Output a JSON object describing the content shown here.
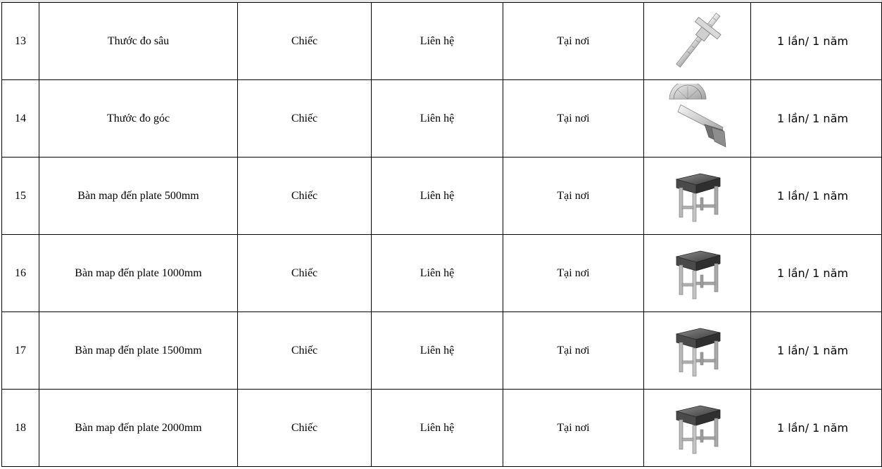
{
  "rows": [
    {
      "no": "13",
      "name": "Thước đo sâu",
      "unit": "Chiếc",
      "price": "Liên hệ",
      "place": "Tại nơi",
      "image": "depth-gauge-icon",
      "frequency": "1 lần/ 1 năm"
    },
    {
      "no": "14",
      "name": "Thước đo góc",
      "unit": "Chiếc",
      "price": "Liên hệ",
      "place": "Tại nơi",
      "image": "protractor-icon",
      "frequency": "1 lần/ 1 năm"
    },
    {
      "no": "15",
      "name": "Bàn map đến plate 500mm",
      "unit": "Chiếc",
      "price": "Liên hệ",
      "place": "Tại nơi",
      "image": "surface-plate-icon",
      "frequency": "1 lần/ 1 năm"
    },
    {
      "no": "16",
      "name": "Bàn map đến plate 1000mm",
      "unit": "Chiếc",
      "price": "Liên hệ",
      "place": "Tại nơi",
      "image": "surface-plate-icon",
      "frequency": "1 lần/ 1 năm"
    },
    {
      "no": "17",
      "name": "Bàn map đến plate 1500mm",
      "unit": "Chiếc",
      "price": "Liên hệ",
      "place": "Tại nơi",
      "image": "surface-plate-icon",
      "frequency": "1 lần/ 1 năm"
    },
    {
      "no": "18",
      "name": "Bàn map đến plate 2000mm",
      "unit": "Chiếc",
      "price": "Liên hệ",
      "place": "Tại nơi",
      "image": "surface-plate-icon",
      "frequency": "1 lần/ 1 năm"
    }
  ]
}
